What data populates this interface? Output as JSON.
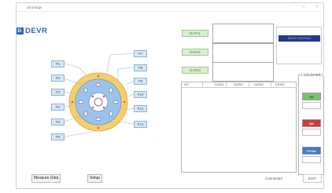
{
  "window": {
    "title": "Strontage",
    "controls": [
      "–",
      "□",
      "✕"
    ]
  },
  "logo": {
    "text": "DEVR",
    "mark": "D"
  },
  "pins_left": [
    "P1",
    "P2",
    "P3",
    "P4",
    "P5",
    "P6"
  ],
  "pins_right": [
    "P7",
    "P8",
    "P9",
    "P10",
    "P11",
    "P12"
  ],
  "inputs": [
    {
      "label": "DATA1",
      "value": ""
    },
    {
      "label": "DATA2",
      "value": ""
    },
    {
      "label": "DATA3",
      "value": ""
    }
  ],
  "badge": {
    "text": "DEVR TESTING"
  },
  "table": {
    "columns": [
      "NO",
      "DATA1",
      "DATA2",
      "DATA3",
      "DATA4"
    ]
  },
  "counter": {
    "title": "COUNTER",
    "ok_label": "OK",
    "ng_label": "NG",
    "total_label": "TOTAL",
    "ok_color": "#7cc36a",
    "ng_color": "#cc3b36",
    "total_color": "#3f78c6"
  },
  "tabs": {
    "measure": "Measure Data",
    "setup": "Setup"
  },
  "status": {
    "text": "Connected",
    "exit_label": "EXIT"
  },
  "colors": {
    "brand": "#2e63b8",
    "connector_ring": "#f4cf6a",
    "connector_center": "#9ec3ea"
  }
}
